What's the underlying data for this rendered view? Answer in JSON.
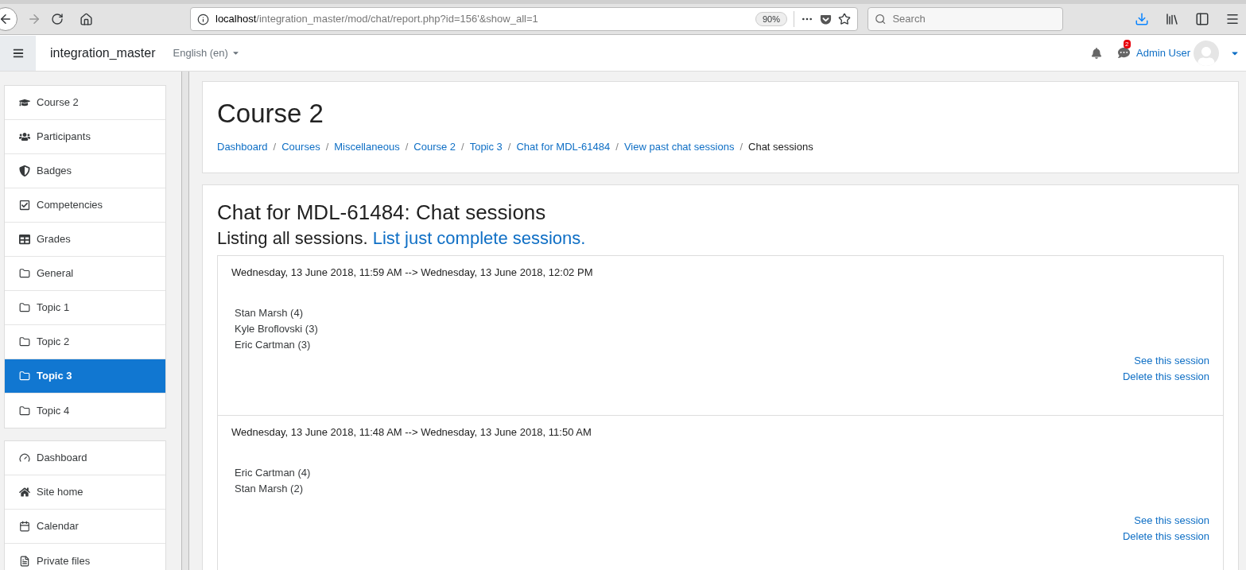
{
  "browser": {
    "url": {
      "host": "localhost",
      "path": "/integration_master/mod/chat/report.php?id=156'&show_all=1"
    },
    "zoom": "90%",
    "search": {
      "placeholder": "Search"
    }
  },
  "navbar": {
    "site_name": "integration_master",
    "language": "English (en)",
    "messages_badge": "2",
    "user": "Admin User"
  },
  "sidebar": {
    "groups": [
      {
        "items": [
          {
            "label": "Course 2",
            "selected": false
          },
          {
            "label": "Participants",
            "selected": false
          },
          {
            "label": "Badges",
            "selected": false
          },
          {
            "label": "Competencies",
            "selected": false
          },
          {
            "label": "Grades",
            "selected": false
          },
          {
            "label": "General",
            "selected": false
          },
          {
            "label": "Topic 1",
            "selected": false
          },
          {
            "label": "Topic 2",
            "selected": false
          },
          {
            "label": "Topic 3",
            "selected": true
          },
          {
            "label": "Topic 4",
            "selected": false
          }
        ]
      },
      {
        "items": [
          {
            "label": "Dashboard",
            "selected": false
          },
          {
            "label": "Site home",
            "selected": false
          },
          {
            "label": "Calendar",
            "selected": false
          },
          {
            "label": "Private files",
            "selected": false
          }
        ]
      }
    ]
  },
  "header": {
    "title": "Course 2",
    "breadcrumb": {
      "separator": "/",
      "items": [
        {
          "label": "Dashboard",
          "link": true
        },
        {
          "label": "Courses",
          "link": true
        },
        {
          "label": "Miscellaneous",
          "link": true
        },
        {
          "label": "Course 2",
          "link": true
        },
        {
          "label": "Topic 3",
          "link": true
        },
        {
          "label": "Chat for MDL-61484",
          "link": true
        },
        {
          "label": "View past chat sessions",
          "link": true
        },
        {
          "label": "Chat sessions",
          "link": false
        }
      ]
    }
  },
  "main": {
    "title": "Chat for MDL-61484: Chat sessions",
    "listing_text": "Listing all sessions.",
    "listing_link": "List just complete sessions.",
    "sessions": [
      {
        "period": "Wednesday, 13 June 2018, 11:59 AM --> Wednesday, 13 June 2018, 12:02 PM",
        "users": [
          "Stan Marsh (4)",
          "Kyle Broflovski (3)",
          "Eric Cartman (3)"
        ],
        "links": [
          "See this session",
          "Delete this session"
        ]
      },
      {
        "period": "Wednesday, 13 June 2018, 11:48 AM --> Wednesday, 13 June 2018, 11:50 AM",
        "users": [
          "Eric Cartman (4)",
          "Stan Marsh (2)"
        ],
        "links": [
          "See this session",
          "Delete this session"
        ]
      }
    ]
  }
}
